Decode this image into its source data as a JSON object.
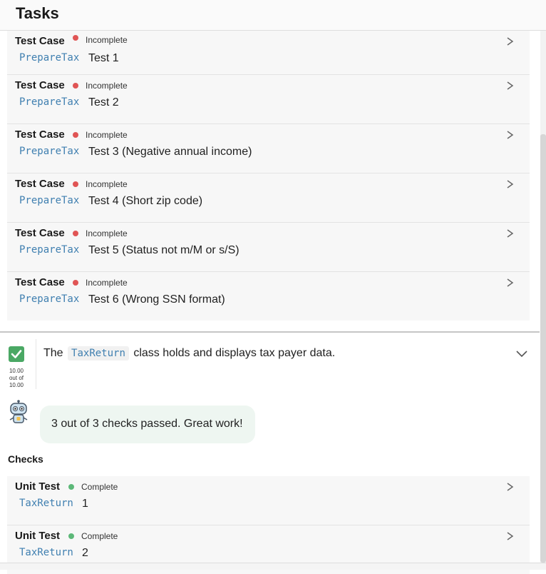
{
  "header": {
    "title": "Tasks"
  },
  "test_cases": [
    {
      "title": "Test Case",
      "status": "Incomplete",
      "code": "PrepareTax",
      "text": "Test 1"
    },
    {
      "title": "Test Case",
      "status": "Incomplete",
      "code": "PrepareTax",
      "text": "Test 2"
    },
    {
      "title": "Test Case",
      "status": "Incomplete",
      "code": "PrepareTax",
      "text": "Test 3 (Negative annual income)"
    },
    {
      "title": "Test Case",
      "status": "Incomplete",
      "code": "PrepareTax",
      "text": "Test 4 (Short zip code)"
    },
    {
      "title": "Test Case",
      "status": "Incomplete",
      "code": "PrepareTax",
      "text": "Test 5 (Status not m/M or s/S)"
    },
    {
      "title": "Test Case",
      "status": "Incomplete",
      "code": "PrepareTax",
      "text": "Test 6 (Wrong SSN format)"
    }
  ],
  "task": {
    "score": "10.00",
    "score_out_of": "out of",
    "score_total": "10.00",
    "desc_prefix": "The",
    "desc_code": "TaxReturn",
    "desc_suffix": "class holds and displays tax payer data."
  },
  "feedback": {
    "message": "3 out of 3 checks passed. Great work!"
  },
  "checks": {
    "heading": "Checks",
    "items": [
      {
        "title": "Unit Test",
        "status": "Complete",
        "code": "TaxReturn",
        "text": "1"
      },
      {
        "title": "Unit Test",
        "status": "Complete",
        "code": "TaxReturn",
        "text": "2"
      }
    ]
  },
  "colors": {
    "incomplete": "#e05555",
    "complete": "#5cb878",
    "code": "#3f7fb0",
    "check": "#4aa864",
    "bubble": "#eef6f1"
  },
  "icons": {
    "row_chevron": "chevron-right-icon",
    "expand": "chevron-down-icon",
    "check": "checkmark-icon",
    "avatar": "robot-icon"
  }
}
